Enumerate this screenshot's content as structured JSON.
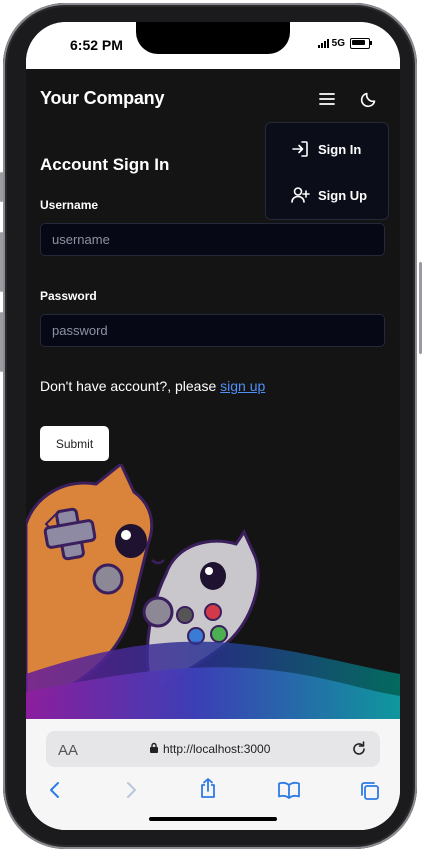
{
  "status": {
    "time": "6:52 PM",
    "network": "5G"
  },
  "app": {
    "brand": "Your Company",
    "icons": {
      "menu": "hamburger-menu-icon",
      "theme": "moon-icon"
    },
    "dropdown": {
      "items": [
        {
          "label": "Sign In",
          "icon": "sign-in-icon"
        },
        {
          "label": "Sign Up",
          "icon": "user-plus-icon"
        }
      ]
    },
    "form": {
      "title": "Account Sign In",
      "username_label": "Username",
      "username_placeholder": "username",
      "username_value": "",
      "password_label": "Password",
      "password_placeholder": "password",
      "password_value": "",
      "hint_prefix": "Don't have account?, please",
      "hint_link": "sign up",
      "submit_label": "Submit"
    },
    "colors": {
      "background": "#141414",
      "input_background": "#060816",
      "link": "#4f8ff7",
      "accent_gradient": [
        "#7b1fa2",
        "#3f51b5",
        "#00897b"
      ]
    }
  },
  "browser": {
    "text_size_label": "AA",
    "url": "http://localhost:3000",
    "icons": [
      "back-icon",
      "forward-icon",
      "share-icon",
      "bookmarks-icon",
      "tabs-icon"
    ]
  }
}
